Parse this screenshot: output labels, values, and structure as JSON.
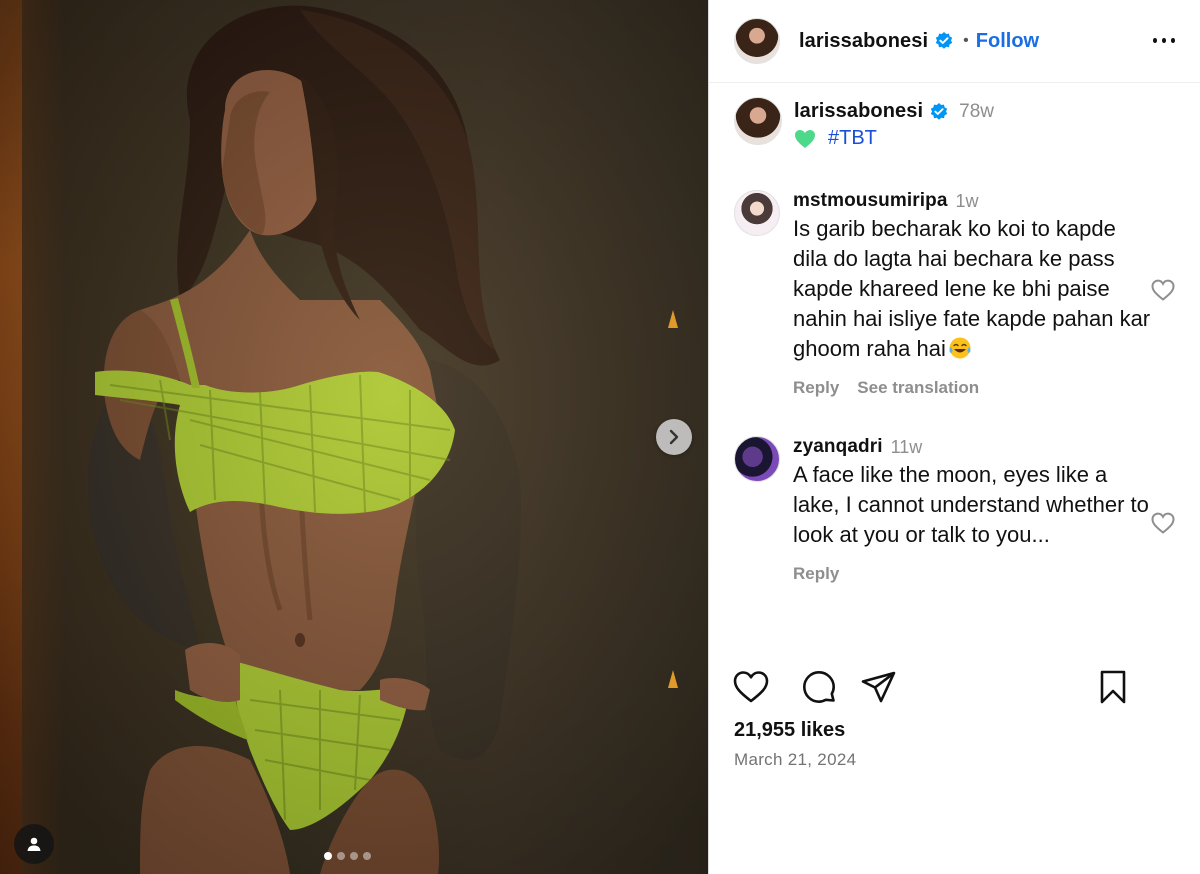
{
  "post": {
    "author": {
      "username": "larissabonesi",
      "verified": true
    },
    "follow_label": "Follow",
    "separator": "•",
    "caption": {
      "time": "78w",
      "emoji": "green-heart",
      "hashtag": "#TBT"
    },
    "media": {
      "slide_count": 4,
      "active_slide": 1
    },
    "likes_text": "21,955 likes",
    "date_text": "March 21, 2024"
  },
  "comments": [
    {
      "username": "mstmousumiripa",
      "time": "1w",
      "text": "Is garib becharak ko koi to kapde dila do lagta hai bechara ke pass kapde khareed lene ke bhi paise nahin hai isliye fate kapde pahan kar ghoom raha hai",
      "emoji": "face-with-tears-of-joy",
      "reply_label": "Reply",
      "translate_label": "See translation"
    },
    {
      "username": "zyanqadri",
      "time": "11w",
      "text": "A face like the moon, eyes like a lake, I cannot understand whether to look at you or talk to you...",
      "reply_label": "Reply"
    }
  ],
  "icons": {
    "like": "heart-outline-icon",
    "comment": "comment-bubble-icon",
    "share": "paper-plane-icon",
    "save": "bookmark-icon",
    "more": "more-horizontal-icon",
    "next": "chevron-right-icon",
    "tags": "user-tag-icon"
  },
  "colors": {
    "follow": "#1a6ee5",
    "hashtag": "#1a4fd6",
    "secondary_text": "#8e8e8e",
    "verified": "#0095f6"
  }
}
